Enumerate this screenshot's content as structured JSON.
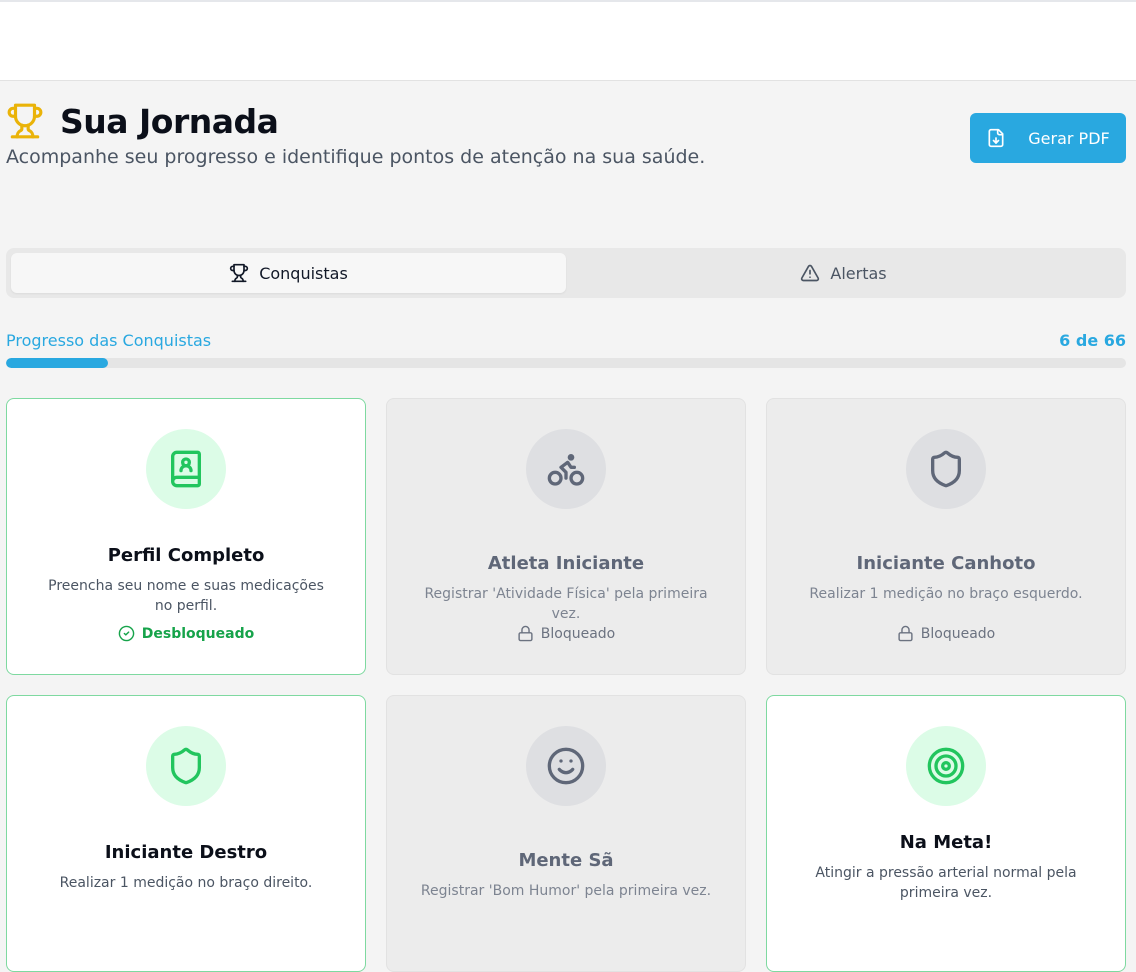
{
  "header": {
    "title": "Sua Jornada",
    "subtitle": "Acompanhe seu progresso e identifique pontos de atenção na sua saúde.",
    "icon": "trophy-icon",
    "pdf_button": "Gerar PDF"
  },
  "tabs": [
    {
      "label": "Conquistas",
      "icon": "trophy-icon",
      "active": true
    },
    {
      "label": "Alertas",
      "icon": "alert-triangle-icon",
      "active": false
    }
  ],
  "progress": {
    "label": "Progresso das Conquistas",
    "count_text": "6 de 66",
    "unlocked": 6,
    "total": 66
  },
  "achievements": [
    {
      "title": "Perfil Completo",
      "description": "Preencha seu nome e suas medicações no perfil.",
      "status": "Desbloqueado",
      "unlocked": true,
      "icon": "contact-book-icon"
    },
    {
      "title": "Atleta Iniciante",
      "description": "Registrar 'Atividade Física' pela primeira vez.",
      "status": "Bloqueado",
      "unlocked": false,
      "icon": "bike-icon"
    },
    {
      "title": "Iniciante Canhoto",
      "description": "Realizar 1 medição no braço esquerdo.",
      "status": "Bloqueado",
      "unlocked": false,
      "icon": "shield-icon"
    },
    {
      "title": "Iniciante Destro",
      "description": "Realizar 1 medição no braço direito.",
      "status": "",
      "unlocked": true,
      "icon": "shield-icon"
    },
    {
      "title": "Mente Sã",
      "description": "Registrar 'Bom Humor' pela primeira vez.",
      "status": "",
      "unlocked": false,
      "icon": "smile-icon"
    },
    {
      "title": "Na Meta!",
      "description": "Atingir a pressão arterial normal pela primeira vez.",
      "status": "",
      "unlocked": true,
      "icon": "target-icon"
    }
  ],
  "colors": {
    "accent": "#29a8e0",
    "success": "#16a34a",
    "success_bg": "#dcfce7",
    "trophy": "#eab308",
    "locked_icon": "#5f6778"
  }
}
